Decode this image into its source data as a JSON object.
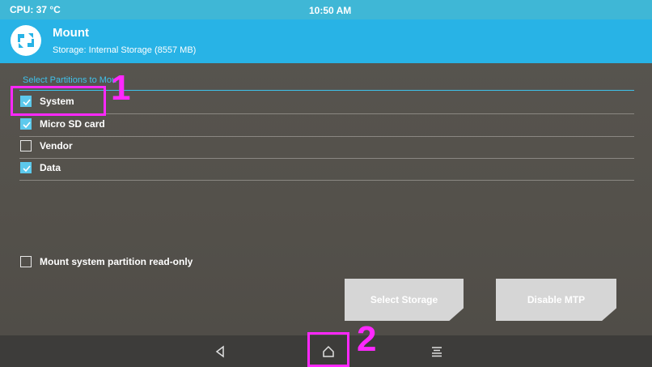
{
  "status": {
    "cpu": "CPU: 37 °C",
    "time": "10:50 AM"
  },
  "header": {
    "title": "Mount",
    "subtitle": "Storage: Internal Storage (8557 MB)",
    "logo_icon": "twrp-logo-icon"
  },
  "section": {
    "title": "Select Partitions to Mou"
  },
  "partitions": [
    {
      "label": "System",
      "checked": true
    },
    {
      "label": "Micro SD card",
      "checked": true
    },
    {
      "label": "Vendor",
      "checked": false
    },
    {
      "label": "Data",
      "checked": true
    }
  ],
  "readonly_option": {
    "label": "Mount system partition read-only",
    "checked": false
  },
  "buttons": {
    "select_storage": "Select Storage",
    "disable_mtp": "Disable MTP"
  },
  "nav": {
    "back_icon": "back-triangle-icon",
    "home_icon": "home-icon",
    "menu_icon": "menu-lines-icon"
  },
  "annotations": {
    "label1": "1",
    "label2": "2"
  },
  "colors": {
    "header": "#28b3e6",
    "accent": "#3fc1ea",
    "annotation": "#ff28ff",
    "background": "#57544f",
    "button": "#d6d6d6"
  }
}
